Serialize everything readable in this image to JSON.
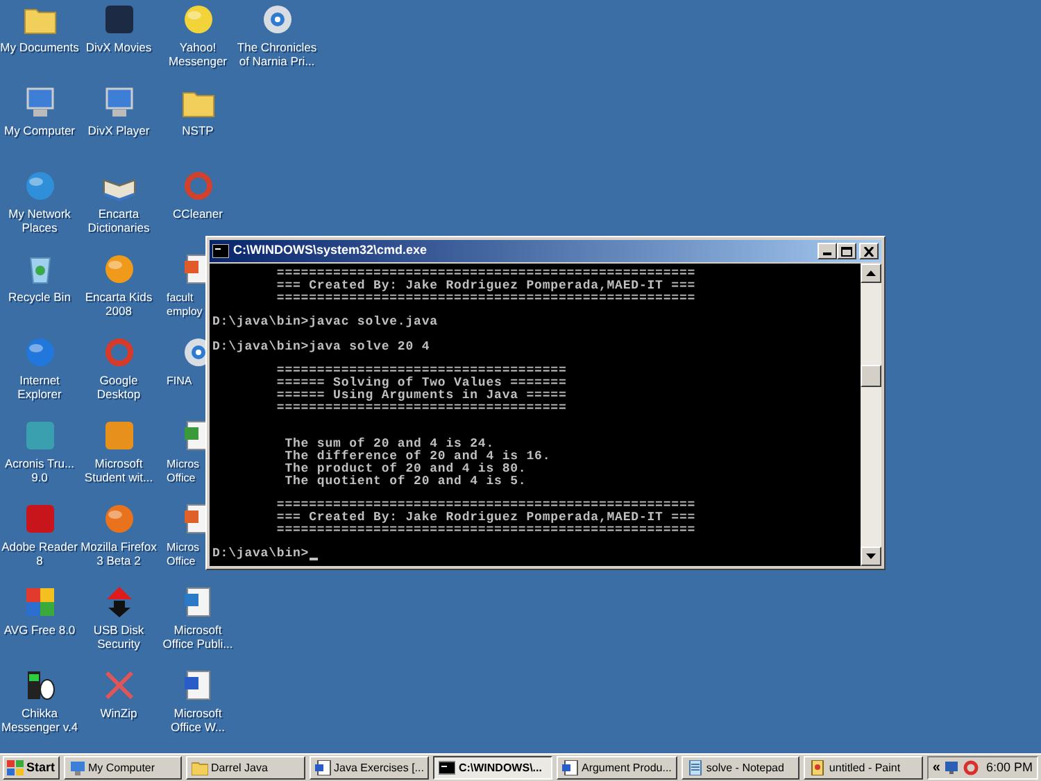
{
  "desktop_icons": [
    {
      "label_lines": [
        "My Documents"
      ],
      "clipped": false
    },
    {
      "label_lines": [
        "My Computer"
      ],
      "clipped": false
    },
    {
      "label_lines": [
        "My Network",
        "Places"
      ],
      "clipped": false
    },
    {
      "label_lines": [
        "Recycle Bin"
      ],
      "clipped": false
    },
    {
      "label_lines": [
        "Internet",
        "Explorer"
      ],
      "clipped": false
    },
    {
      "label_lines": [
        "Acronis Tru...",
        "9.0"
      ],
      "clipped": false
    },
    {
      "label_lines": [
        "Adobe Reader",
        "8"
      ],
      "clipped": false
    },
    {
      "label_lines": [
        "AVG Free 8.0"
      ],
      "clipped": false
    },
    {
      "label_lines": [
        "Chikka",
        "Messenger v.4"
      ],
      "clipped": false
    },
    {
      "label_lines": [
        "DivX Movies"
      ],
      "clipped": false
    },
    {
      "label_lines": [
        "DivX Player"
      ],
      "clipped": false
    },
    {
      "label_lines": [
        "Encarta",
        "Dictionaries"
      ],
      "clipped": false
    },
    {
      "label_lines": [
        "Encarta Kids",
        "2008"
      ],
      "clipped": false
    },
    {
      "label_lines": [
        "Google",
        "Desktop"
      ],
      "clipped": false
    },
    {
      "label_lines": [
        "Microsoft",
        "Student wit..."
      ],
      "clipped": false
    },
    {
      "label_lines": [
        "Mozilla Firefox",
        "3 Beta 2"
      ],
      "clipped": false
    },
    {
      "label_lines": [
        "USB Disk",
        "Security"
      ],
      "clipped": false
    },
    {
      "label_lines": [
        "WinZip"
      ],
      "clipped": false
    },
    {
      "label_lines": [
        "Yahoo!",
        "Messenger"
      ],
      "clipped": false
    },
    {
      "label_lines": [
        "NSTP"
      ],
      "clipped": false
    },
    {
      "label_lines": [
        "CCleaner"
      ],
      "clipped": false
    },
    {
      "label_lines": [
        "facult",
        "employ"
      ],
      "clipped": true
    },
    {
      "label_lines": [
        "FINA"
      ],
      "clipped": true
    },
    {
      "label_lines": [
        "Micros",
        "Office"
      ],
      "clipped": true
    },
    {
      "label_lines": [
        "Micros",
        "Office"
      ],
      "clipped": true
    },
    {
      "label_lines": [
        "Microsoft",
        "Office Publi..."
      ],
      "clipped": false
    },
    {
      "label_lines": [
        "Microsoft",
        "Office W..."
      ],
      "clipped": false
    },
    {
      "label_lines": [
        "The Chronicles",
        "of Narnia Pri..."
      ],
      "clipped": false
    }
  ],
  "console_window": {
    "title": "C:\\WINDOWS\\system32\\cmd.exe",
    "blocks": [
      {
        "lines": [
          "        ====================================================",
          "        === Created By: Jake Rodriguez Pomperada,MAED-IT ===",
          "        ===================================================="
        ]
      },
      {
        "lines": [
          "D:\\java\\bin>javac solve.java"
        ]
      },
      {
        "lines": [
          "D:\\java\\bin>java solve 20 4"
        ]
      },
      {
        "lines": [
          "        ====================================",
          "        ====== Solving of Two Values =======",
          "        ====== Using Arguments in Java =====",
          "        ===================================="
        ]
      },
      {
        "lines": [
          "         The sum of 20 and 4 is 24.",
          "         The difference of 20 and 4 is 16.",
          "         The product of 20 and 4 is 80.",
          "         The quotient of 20 and 4 is 5."
        ]
      },
      {
        "lines": [
          "        ====================================================",
          "        === Created By: Jake Rodriguez Pomperada,MAED-IT ===",
          "        ===================================================="
        ]
      },
      {
        "lines": [
          "D:\\java\\bin>"
        ],
        "cursor": true
      }
    ]
  },
  "taskbar": {
    "start": "Start",
    "buttons": [
      {
        "label": "My Computer",
        "selected": false
      },
      {
        "label": "Darrel Java",
        "selected": false
      },
      {
        "label": "Java Exercises [...",
        "selected": false
      },
      {
        "label": "C:\\WINDOWS\\...",
        "selected": true
      },
      {
        "label": "Argument Produ...",
        "selected": false
      },
      {
        "label": "solve - Notepad",
        "selected": false
      },
      {
        "label": "untitled - Paint",
        "selected": false
      }
    ],
    "tray": {
      "chevron": "«",
      "time": "6:00 PM"
    }
  }
}
